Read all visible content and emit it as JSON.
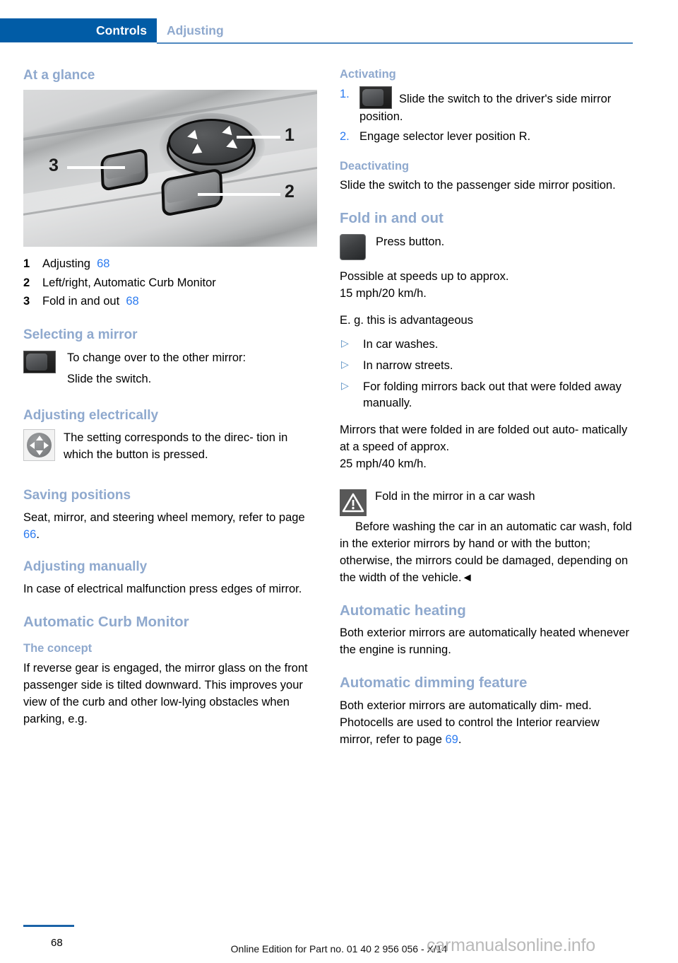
{
  "header": {
    "active_tab": "Controls",
    "inactive_tab": "Adjusting",
    "active_bg": "#015ca6",
    "inactive_color": "#8fa9ce"
  },
  "colors": {
    "heading_blue": "#8fa9ce",
    "link_blue": "#2c7bf0",
    "banner_blue": "#015ca6",
    "rule_blue": "#4f89c0"
  },
  "left_column": {
    "at_a_glance": {
      "heading": "At a glance",
      "figure": {
        "callouts": [
          {
            "num": "1",
            "label": "joystick-control"
          },
          {
            "num": "2",
            "label": "rocker-switch"
          },
          {
            "num": "3",
            "label": "fold-button"
          }
        ]
      },
      "legend": [
        {
          "num": "1",
          "text": "Adjusting",
          "page": "68"
        },
        {
          "num": "2",
          "text": "Left/right, Automatic Curb Monitor",
          "page": ""
        },
        {
          "num": "3",
          "text": "Fold in and out",
          "page": "68"
        }
      ]
    },
    "selecting_a_mirror": {
      "heading": "Selecting a mirror",
      "line1": "To change over to the other mirror:",
      "line2": "Slide the switch."
    },
    "adjusting_electrically": {
      "heading": "Adjusting electrically",
      "text": "The setting corresponds to the direc‑ tion in which the button is pressed."
    },
    "saving_positions": {
      "heading": "Saving positions",
      "text_before": "Seat, mirror, and steering wheel memory, refer to page ",
      "page": "66",
      "text_after": "."
    },
    "adjusting_manually": {
      "heading": "Adjusting manually",
      "text": "In case of electrical malfunction press edges of mirror."
    },
    "automatic_curb_monitor": {
      "heading": "Automatic Curb Monitor",
      "the_concept": {
        "heading": "The concept",
        "text": "If reverse gear is engaged, the mirror glass on the front passenger side is tilted downward. This improves your view of the curb and other low-lying obstacles when parking, e.g."
      }
    }
  },
  "right_column": {
    "activating": {
      "heading": "Activating",
      "steps": [
        {
          "num": "1.",
          "text": "Slide the switch to the driver's side mirror position.",
          "icon": "slide-switch-icon"
        },
        {
          "num": "2.",
          "text": "Engage selector lever position R.",
          "icon": ""
        }
      ]
    },
    "deactivating": {
      "heading": "Deactivating",
      "text": "Slide the switch to the passenger side mirror position."
    },
    "fold_in_and_out": {
      "heading": "Fold in and out",
      "press_button_text": "Press button.",
      "speed_note_line1": "Possible at speeds up to approx.",
      "speed_note_line2": "15 mph/20 km/h.",
      "eg_line": "E. g. this is advantageous",
      "bullets": [
        "In car washes.",
        "In narrow streets.",
        "For folding mirrors back out that were folded away manually."
      ],
      "auto_unfold_line1": "Mirrors that were folded in are folded out auto‑ matically at a speed of approx.",
      "auto_unfold_line2": "25 mph/40 km/h.",
      "warning": {
        "title": "Fold in the mirror in a car wash",
        "body": "Before washing the car in an automatic car wash, fold in the exterior mirrors by hand or with the button; otherwise, the mirrors could be damaged, depending on the width of the vehicle.",
        "end_mark": "◄"
      }
    },
    "automatic_heating": {
      "heading": "Automatic heating",
      "text": "Both exterior mirrors are automatically heated whenever the engine is running."
    },
    "automatic_dimming_feature": {
      "heading": "Automatic dimming feature",
      "text_before": "Both exterior mirrors are automatically dim‑ med. Photocells are used to control the Interior rearview mirror, refer to page ",
      "page": "69",
      "text_after": "."
    }
  },
  "footer": {
    "page_number": "68",
    "edition_text": "Online Edition for Part no. 01 40 2 956 056 - X/14",
    "watermark": "carmanualsonline.info"
  }
}
